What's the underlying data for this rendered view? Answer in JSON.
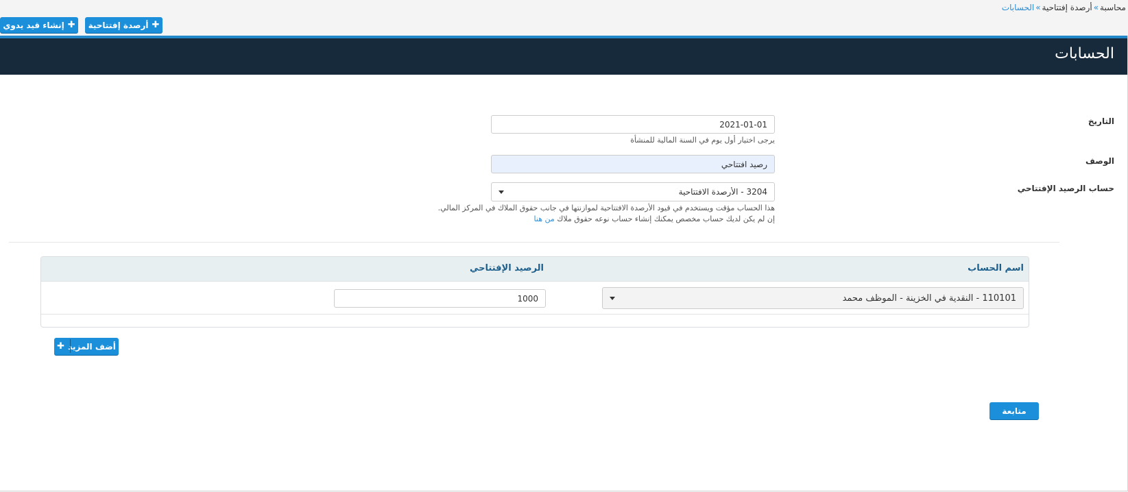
{
  "breadcrumb": {
    "items": [
      "محاسبة",
      "أرصدة إفتتاحية",
      "الحسابات"
    ],
    "separator": "»"
  },
  "toolbar": {
    "opening_balances_label": "أرصدة إفتتاحية",
    "manual_entry_label": "إنشاء قيد يدوي",
    "plus_icon": "✚"
  },
  "panel": {
    "title": "الحسابات"
  },
  "form": {
    "date": {
      "label": "التاريخ",
      "value": "2021-01-01",
      "help": "يرجى اختيار أول يوم في السنة المالية للمنشأة"
    },
    "description": {
      "label": "الوصف",
      "value": "رصيد افتتاحي"
    },
    "opening_account": {
      "label": "حساب الرصيد الإفتتاحي",
      "selected": "3204 - الأرصدة الافتتاحية",
      "help1": "هذا الحساب مؤقت ويستخدم في قيود الأرصدة الافتتاحية لموازنتها في جانب حقوق الملاك في المركز المالي.",
      "help2": "إن لم يكن لديك حساب مخصص يمكنك إنشاء حساب نوعه حقوق ملاك",
      "help2_link": "من هنا"
    }
  },
  "table": {
    "headers": {
      "account_name": "اسم الحساب",
      "opening_balance": "الرصيد الإفتتاحي"
    },
    "rows": [
      {
        "account": "110101 - النقدية في الخزينة - الموظف محمد",
        "balance": "1000"
      }
    ]
  },
  "actions": {
    "add_more_label": "أضف المزيد",
    "continue_label": "متابعة"
  },
  "colors": {
    "primary_button": "#1c8fdb",
    "header_bg": "#172a3c",
    "header_accent": "#2187c9",
    "link": "#2b8dd6"
  }
}
